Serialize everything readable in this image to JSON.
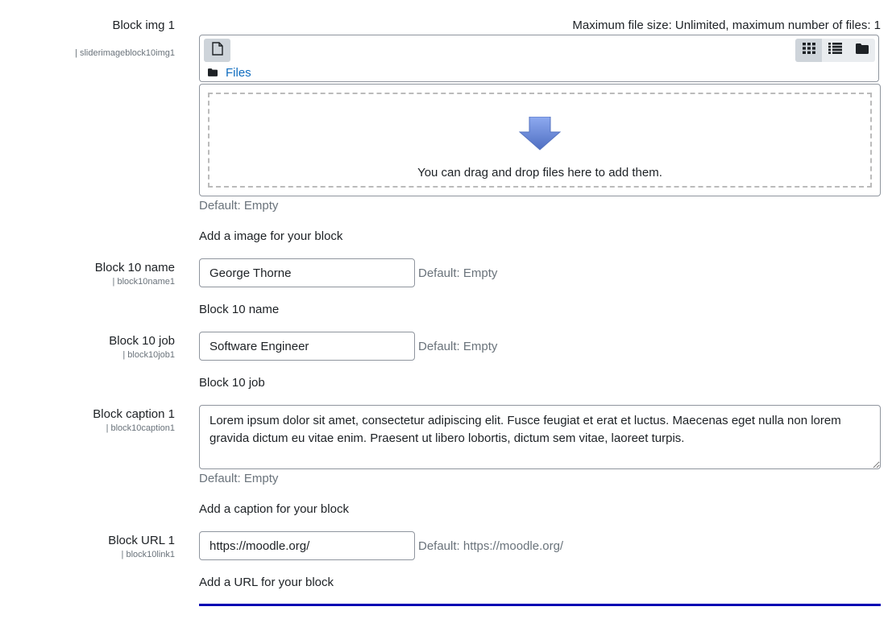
{
  "img_field": {
    "label": "Block img 1",
    "setting_name": "| sliderimageblock10img1",
    "max_info": "Maximum file size: Unlimited, maximum number of files: 1",
    "path_label": "Files",
    "drop_text": "You can drag and drop files here to add them.",
    "default_text": "Default: Empty",
    "description": "Add a image for your block",
    "icons": {
      "add": "file-icon",
      "view_icons": "grid-icon",
      "view_list": "list-icon",
      "view_tree": "folder-icon",
      "path": "folder-icon",
      "drop": "arrow-down-icon"
    }
  },
  "name_field": {
    "label": "Block 10 name",
    "setting_name": "| block10name1",
    "value": "George Thorne",
    "default_text": "Default: Empty",
    "description": "Block 10 name"
  },
  "job_field": {
    "label": "Block 10 job",
    "setting_name": "| block10job1",
    "value": "Software Engineer",
    "default_text": "Default: Empty",
    "description": "Block 10 job"
  },
  "caption_field": {
    "label": "Block caption 1",
    "setting_name": "| block10caption1",
    "value": "Lorem ipsum dolor sit amet, consectetur adipiscing elit. Fusce feugiat et erat et luctus. Maecenas eget nulla non lorem gravida dictum eu vitae enim. Praesent ut libero lobortis, dictum sem vitae, laoreet turpis.",
    "default_text": "Default: Empty",
    "description": "Add a caption for your block"
  },
  "url_field": {
    "label": "Block URL 1",
    "setting_name": "| block10link1",
    "value": "https://moodle.org/",
    "default_text": "Default: https://moodle.org/",
    "description": "Add a URL for your block"
  },
  "colors": {
    "link": "#0f6cbf",
    "muted": "#6a737b",
    "border": "#8f959e",
    "accent_bar": "#0000b3",
    "arrow": "#6f8fd6"
  }
}
